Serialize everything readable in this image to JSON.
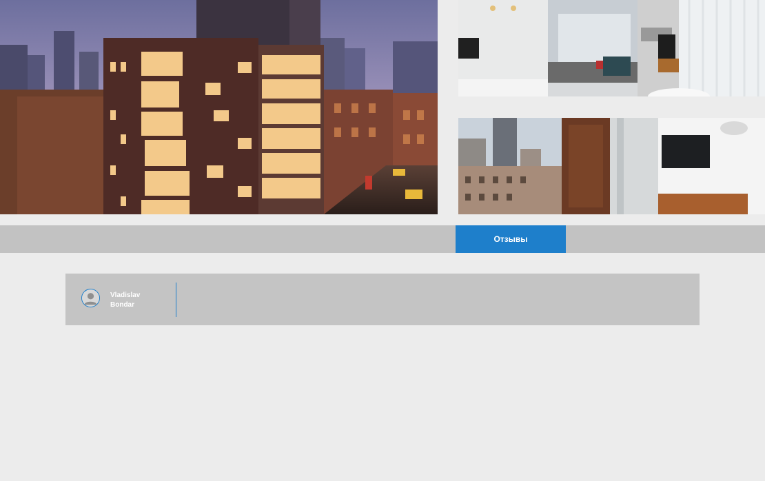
{
  "gallery": {
    "main_photo": "hotel-building-night-photo",
    "room_photo": "hotel-room-interior-photo",
    "view_photo": "balcony-city-view-photo"
  },
  "tabs": {
    "reviews_label": "Отзывы"
  },
  "colors": {
    "accent": "#1e7fcb",
    "tab_bar": "#c2c2c2",
    "card": "#c4c4c4",
    "background": "#ececec"
  },
  "review": {
    "author_first": "Vladislav",
    "author_last": "Bondar",
    "text": ""
  }
}
